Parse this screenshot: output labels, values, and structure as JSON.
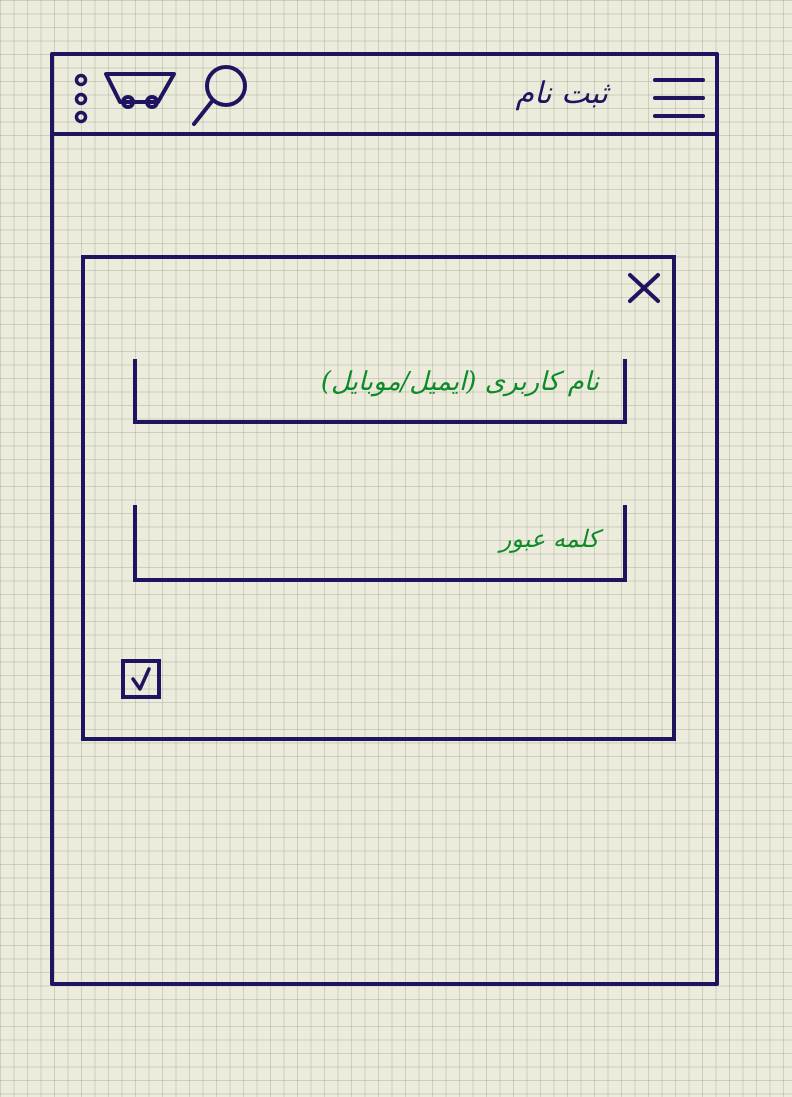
{
  "header": {
    "title": "ثبت نام",
    "icons": [
      "more-vertical-icon",
      "cart-icon",
      "search-icon",
      "menu-icon"
    ]
  },
  "login_modal": {
    "username_placeholder": "نام کاربری (ایمیل/موبایل)",
    "password_placeholder": "کلمه عبور",
    "remember_checked": true,
    "close_icon": "close-icon"
  },
  "colors": {
    "ink": "#1e1460",
    "placeholder_text": "#0e8a2a",
    "paper": "#ecebdc"
  }
}
